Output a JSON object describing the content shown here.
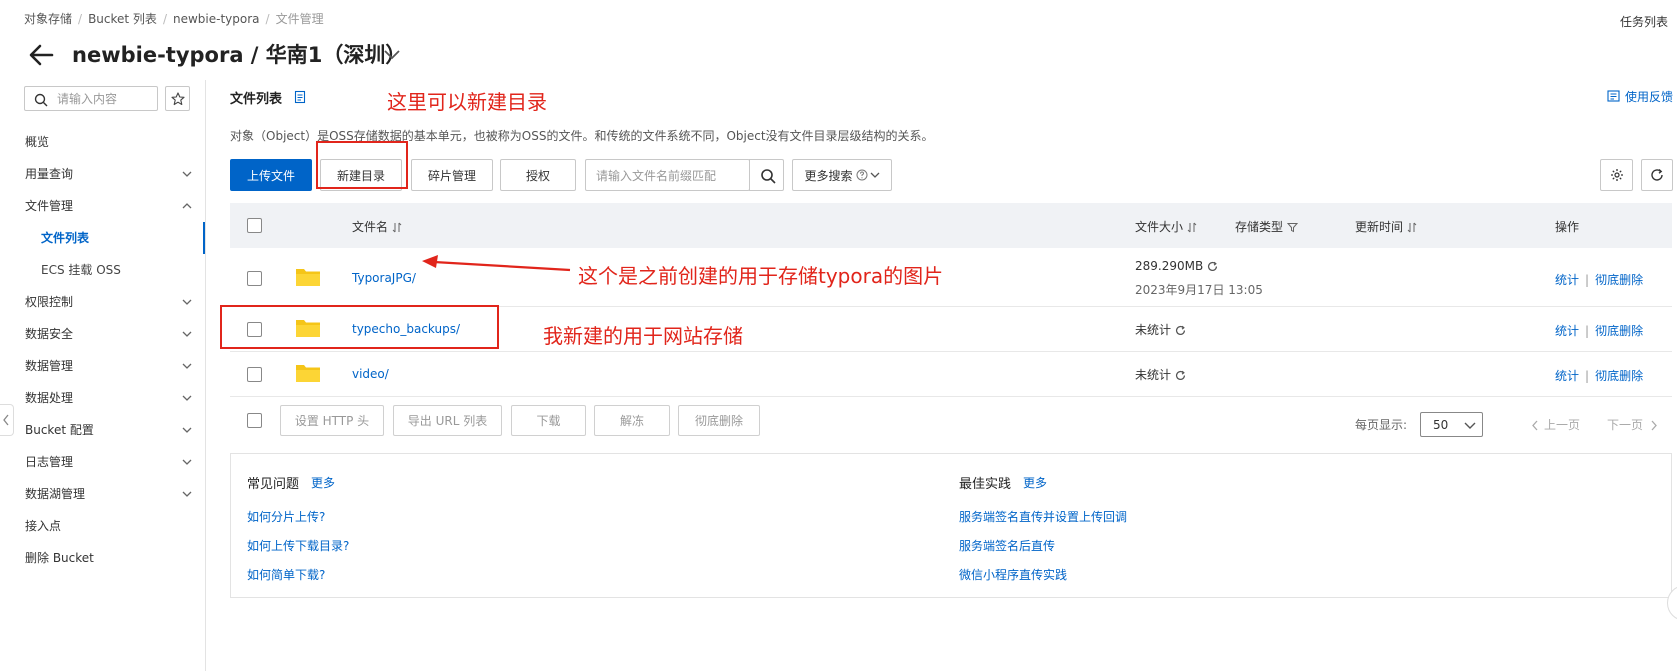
{
  "breadcrumb": [
    "对象存储",
    "Bucket 列表",
    "newbie-typora",
    "文件管理"
  ],
  "task_list": "任务列表",
  "page_title": "newbie-typora / 华南1（深圳）",
  "sidebar": {
    "search_placeholder": "请输入内容",
    "items": [
      {
        "label": "概览"
      },
      {
        "label": "用量查询"
      },
      {
        "label": "文件管理"
      },
      {
        "label": "文件列表"
      },
      {
        "label": "ECS 挂载 OSS"
      },
      {
        "label": "权限控制"
      },
      {
        "label": "数据安全"
      },
      {
        "label": "数据管理"
      },
      {
        "label": "数据处理"
      },
      {
        "label": "Bucket 配置"
      },
      {
        "label": "日志管理"
      },
      {
        "label": "数据湖管理"
      },
      {
        "label": "接入点"
      },
      {
        "label": "删除 Bucket"
      }
    ]
  },
  "main": {
    "title": "文件列表",
    "feedback": "使用反馈",
    "description": "对象（Object）是OSS存储数据的基本单元，也被称为OSS的文件。和传统的文件系统不同，Object没有文件目录层级结构的关系。",
    "toolbar": {
      "upload": "上传文件",
      "new_dir": "新建目录",
      "fragment": "碎片管理",
      "authorize": "授权",
      "search_placeholder": "请输入文件名前缀匹配",
      "more_search": "更多搜索"
    },
    "table": {
      "headers": {
        "name": "文件名",
        "size": "文件大小",
        "storage": "存储类型",
        "updated": "更新时间",
        "actions": "操作"
      },
      "rows": [
        {
          "name": "TyporaJPG/",
          "size": "289.290MB",
          "date": "2023年9月17日 13:05",
          "op_stats": "统计",
          "op_delete": "彻底删除"
        },
        {
          "name": "typecho_backups/",
          "size": "未统计",
          "date": "",
          "op_stats": "统计",
          "op_delete": "彻底删除"
        },
        {
          "name": "video/",
          "size": "未统计",
          "date": "",
          "op_stats": "统计",
          "op_delete": "彻底删除"
        }
      ]
    },
    "batch": {
      "set_http": "设置 HTTP 头",
      "export_url": "导出 URL 列表",
      "download": "下载",
      "unfreeze": "解冻",
      "delete": "彻底删除"
    },
    "pagination": {
      "per_page_label": "每页显示:",
      "per_page_value": "50",
      "prev": "上一页",
      "next": "下一页"
    },
    "help": {
      "faq_title": "常见问题",
      "faq_more": "更多",
      "faq_links": [
        "如何分片上传?",
        "如何上传下载目录?",
        "如何简单下载?"
      ],
      "best_title": "最佳实践",
      "best_more": "更多",
      "best_links": [
        "服务端签名直传并设置上传回调",
        "服务端签名后直传",
        "微信小程序直传实践"
      ]
    }
  },
  "annotations": {
    "new_dir_note": "这里可以新建目录",
    "typora_note": "这个是之前创建的用于存储typora的图片",
    "backup_note": "我新建的用于网站存储"
  },
  "colors": {
    "accent": "#0064c8",
    "annotation": "#e1251b",
    "folder": "#f5c518"
  }
}
